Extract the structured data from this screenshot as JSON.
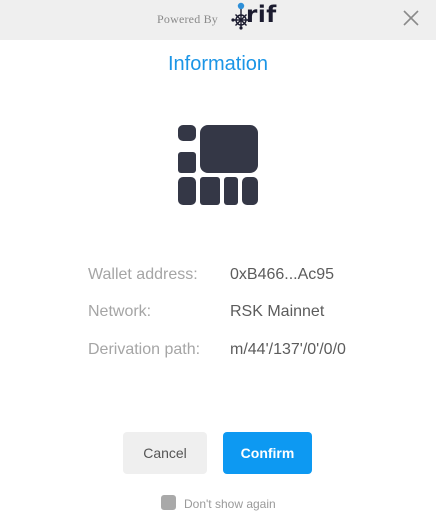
{
  "header": {
    "powered_by": "Powered By",
    "brand": "rif",
    "brand_icon": "rif-network-icon",
    "close_icon": "close-icon"
  },
  "dialog": {
    "title": "Information",
    "wallet_icon": "rsk-wallet-icon",
    "rows": [
      {
        "label": "Wallet address:",
        "value": "0xB466...Ac95"
      },
      {
        "label": "Network:",
        "value": "RSK Mainnet"
      },
      {
        "label": "Derivation path:",
        "value": "m/44'/137'/0'/0/0"
      }
    ],
    "cancel_label": "Cancel",
    "confirm_label": "Confirm",
    "dont_show_label": "Don't show again",
    "dont_show_checked": false
  },
  "colors": {
    "accent": "#1a95e6",
    "confirm_bg": "#0d99f2",
    "cancel_bg": "#efefef",
    "topbar_bg": "#efefef",
    "icon_dark": "#343746"
  }
}
